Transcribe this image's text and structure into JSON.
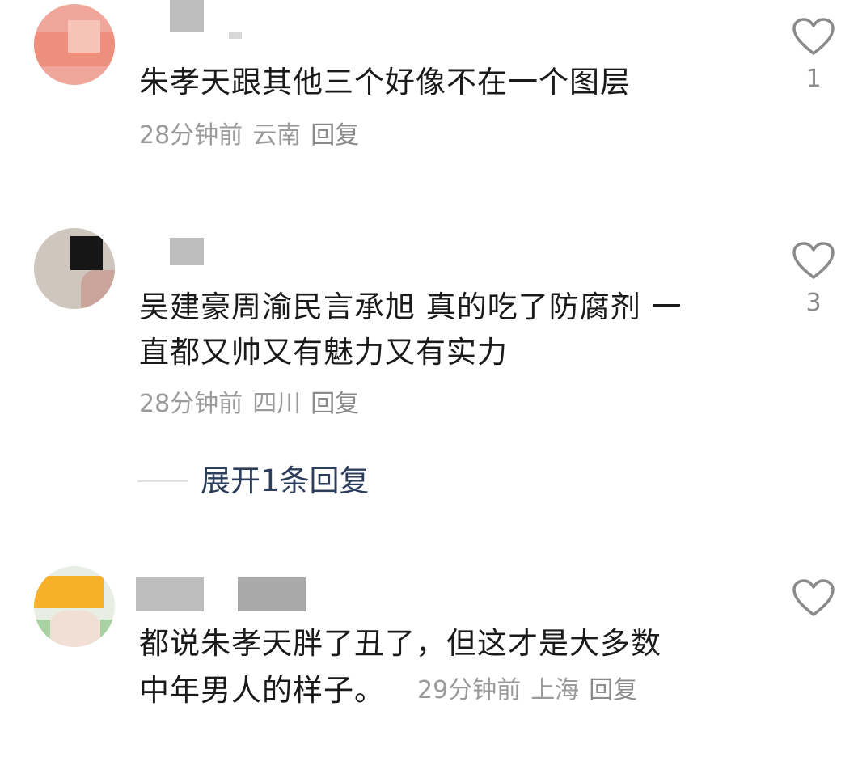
{
  "comments": [
    {
      "text_lines": [
        "朱孝天跟其他三个好像不在一个图层"
      ],
      "time": "28分钟前",
      "location": "云南",
      "reply_label": "回复",
      "likes": "1",
      "like_icon": "heart-outline-icon"
    },
    {
      "text_lines": [
        "吴建豪周渝民言承旭 真的吃了防腐剂 一",
        "直都又帅又有魅力又有实力"
      ],
      "time": "28分钟前",
      "location": "四川",
      "reply_label": "回复",
      "likes": "3",
      "like_icon": "heart-outline-icon",
      "expand_label": "展开1条回复"
    },
    {
      "text_lines": [
        "都说朱孝天胖了丑了，但这才是大多数",
        "中年男人的样子。"
      ],
      "time": "29分钟前",
      "location": "上海",
      "reply_label": "回复",
      "likes": "",
      "like_icon": "heart-outline-icon"
    }
  ],
  "colors": {
    "text": "#1a1a1a",
    "meta": "#9a9a9a",
    "link": "#2c3e5c",
    "icon": "#8a8a8a"
  }
}
